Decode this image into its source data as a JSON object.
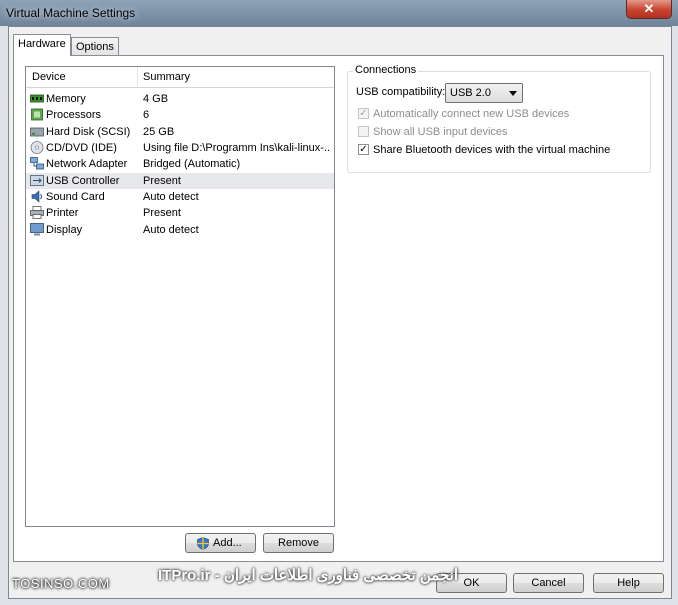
{
  "window": {
    "title": "Virtual Machine Settings",
    "close_glyph": "✕"
  },
  "tabs": [
    {
      "label": "Hardware",
      "active": true
    },
    {
      "label": "Options",
      "active": false
    }
  ],
  "device_list": {
    "columns": [
      "Device",
      "Summary"
    ],
    "rows": [
      {
        "name": "Memory",
        "summary": "4 GB",
        "icon": "memory-icon"
      },
      {
        "name": "Processors",
        "summary": "6",
        "icon": "processor-icon"
      },
      {
        "name": "Hard Disk (SCSI)",
        "summary": "25 GB",
        "icon": "hard-disk-icon"
      },
      {
        "name": "CD/DVD (IDE)",
        "summary": "Using file D:\\Programm Ins\\kali-linux-...",
        "icon": "cd-dvd-icon"
      },
      {
        "name": "Network Adapter",
        "summary": "Bridged (Automatic)",
        "icon": "network-adapter-icon"
      },
      {
        "name": "USB Controller",
        "summary": "Present",
        "icon": "usb-controller-icon",
        "selected": true
      },
      {
        "name": "Sound Card",
        "summary": "Auto detect",
        "icon": "sound-card-icon"
      },
      {
        "name": "Printer",
        "summary": "Present",
        "icon": "printer-icon"
      },
      {
        "name": "Display",
        "summary": "Auto detect",
        "icon": "display-icon"
      }
    ]
  },
  "list_buttons": {
    "add": "Add...",
    "remove": "Remove"
  },
  "connections": {
    "group_label": "Connections",
    "usb_compat_label": "USB compatibility:",
    "usb_compat_value": "USB 2.0",
    "options": [
      {
        "label": "Automatically connect new USB devices",
        "checked": true,
        "disabled": true
      },
      {
        "label": "Show all USB input devices",
        "checked": false,
        "disabled": true
      },
      {
        "label": "Share Bluetooth devices with the virtual machine",
        "checked": true,
        "disabled": false
      }
    ]
  },
  "dialog_buttons": {
    "ok": "OK",
    "cancel": "Cancel",
    "help": "Help"
  },
  "watermark": {
    "left": "TOSINSO.COM",
    "right": "ITPro.ir - انجمن تخصصی فناوری اطلاعات ایران"
  }
}
